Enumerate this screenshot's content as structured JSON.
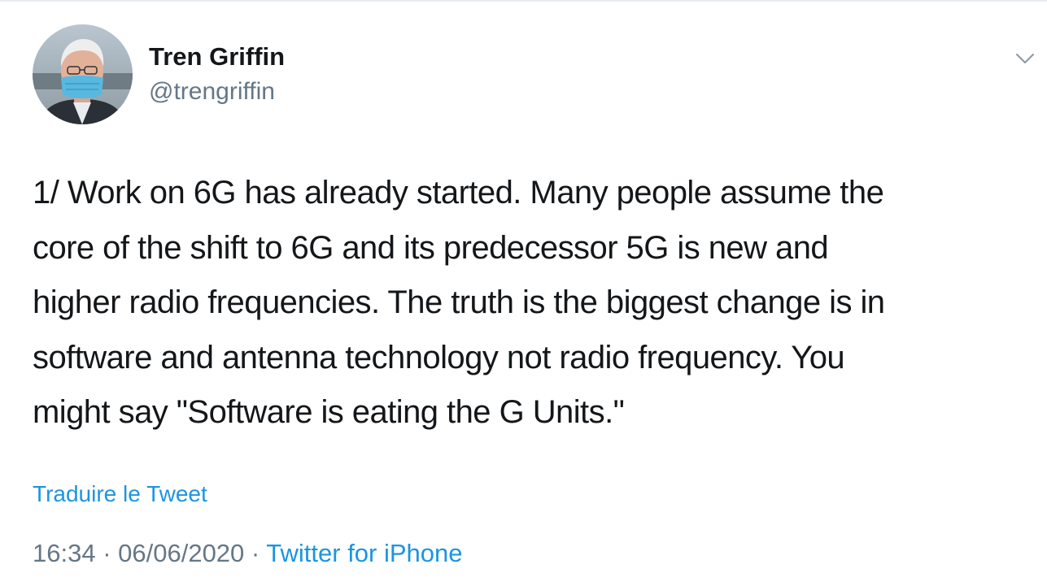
{
  "author": {
    "display_name": "Tren Griffin",
    "handle": "@trengriffin",
    "avatar_icon": "avatar-photo-masked-man"
  },
  "tweet": {
    "text": "1/ Work on 6G has already started. Many people assume the\ncore of the shift to 6G and its predecessor 5G is new and\nhigher radio frequencies. The truth is the biggest change is in\nsoftware and antenna technology not radio frequency. You\nmight say \"Software is eating the G Units.\"",
    "translate_label": "Traduire le Tweet",
    "time": "16:34",
    "date": "06/06/2020",
    "separator": " · ",
    "source": "Twitter for iPhone"
  },
  "menu": {
    "icon": "chevron-down-icon"
  },
  "colors": {
    "text": "#14171a",
    "secondary": "#657786",
    "link": "#1b95e0"
  }
}
